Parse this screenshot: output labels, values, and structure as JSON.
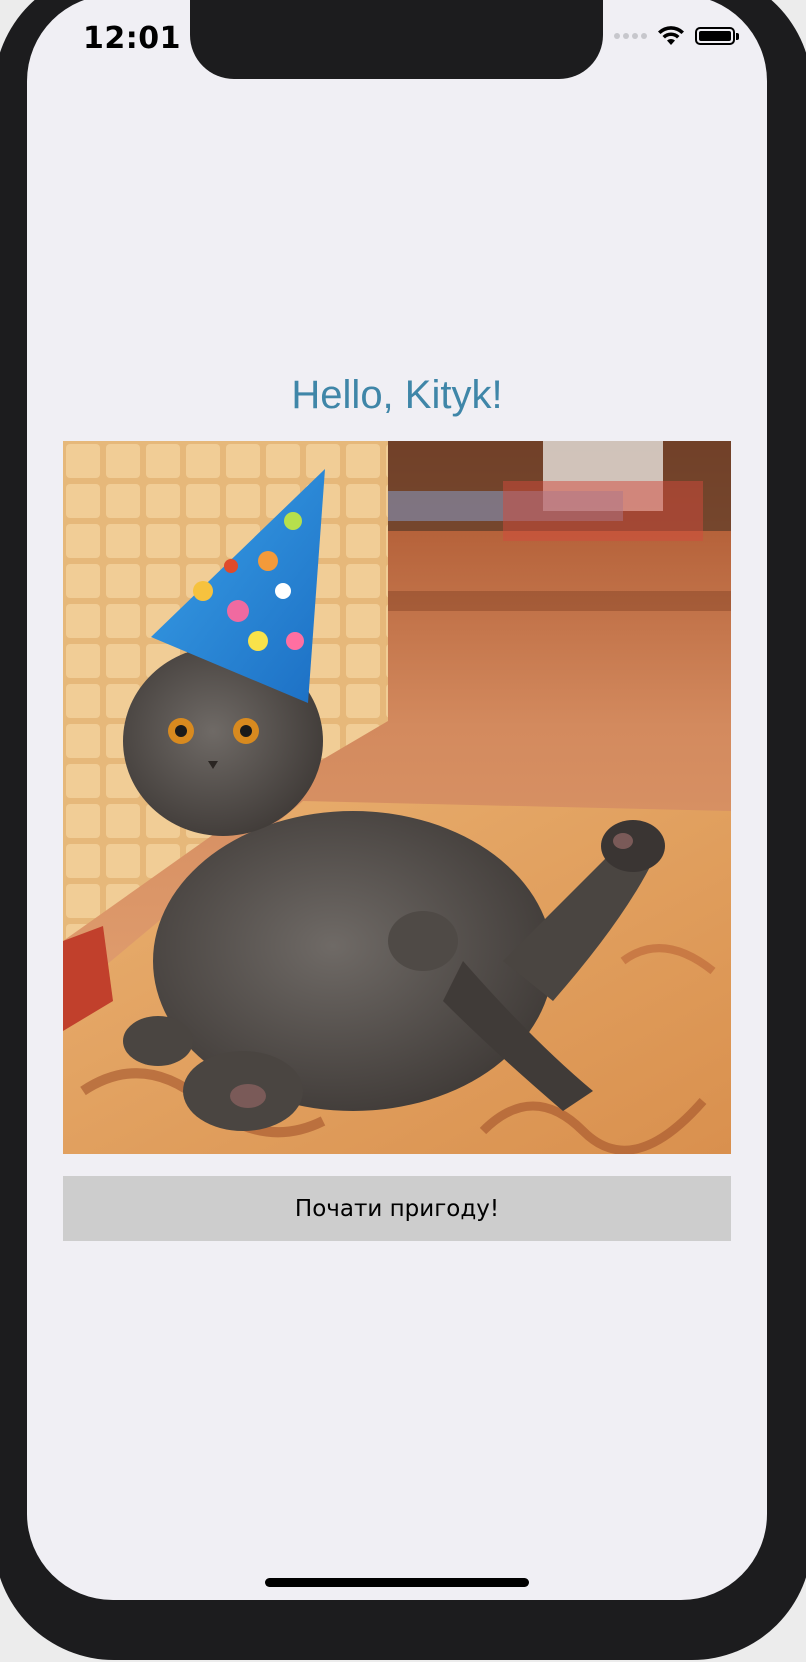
{
  "status_bar": {
    "time": "12:01",
    "icons": [
      "signal-icon",
      "wifi-icon",
      "battery-icon"
    ]
  },
  "content": {
    "title": "Hello, Kityk!",
    "image_subject": "grey cat wearing blue party hat lounging against wall",
    "button_label": "Почати пригоду!"
  },
  "colors": {
    "title": "#3f86a8",
    "screen_background": "#f0eff4",
    "button_background": "#cdcdcd"
  }
}
